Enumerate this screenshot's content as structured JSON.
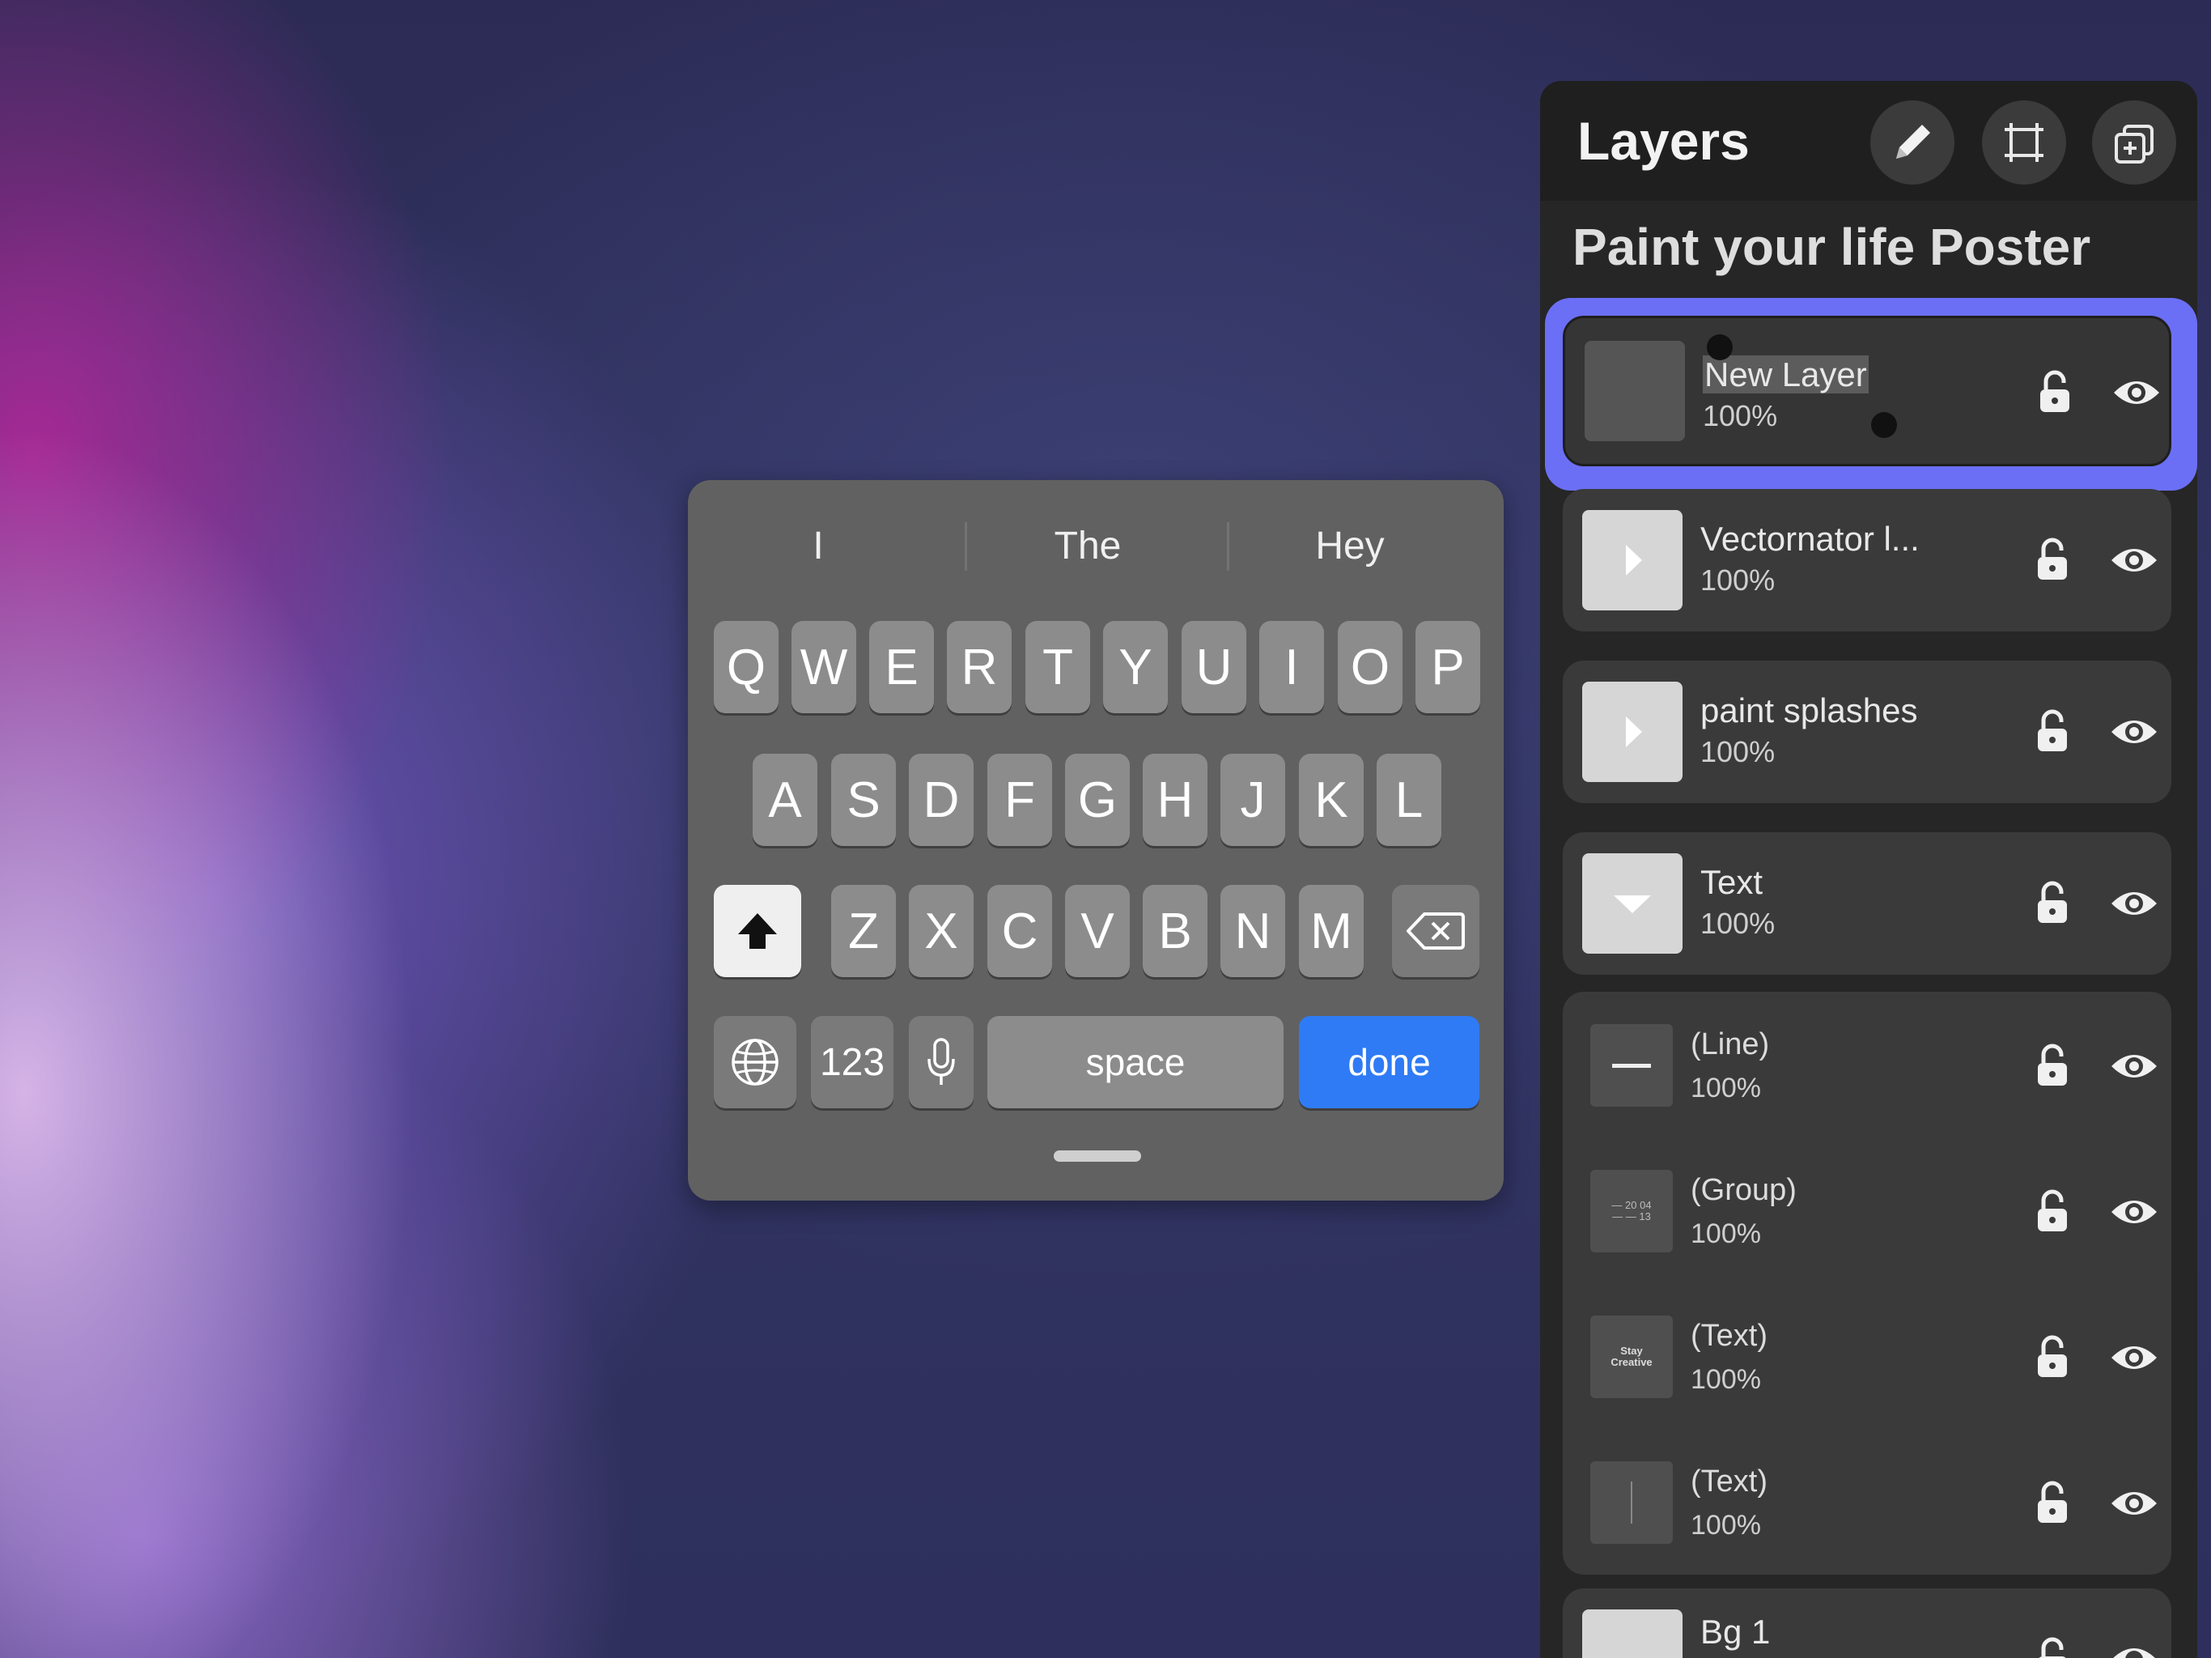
{
  "panel": {
    "title": "Layers",
    "document_title": "Paint your life Poster"
  },
  "layers": [
    {
      "name": "New Layer",
      "opacity": "100%"
    },
    {
      "name": "Vectornator l...",
      "opacity": "100%"
    },
    {
      "name": "paint splashes",
      "opacity": "100%"
    },
    {
      "name": "Text",
      "opacity": "100%"
    }
  ],
  "sublayers": [
    {
      "name": "(Line)",
      "opacity": "100%"
    },
    {
      "name": "(Group)",
      "opacity": "100%",
      "thumb_text": "— 20 04 — — 13"
    },
    {
      "name": "(Text)",
      "opacity": "100%",
      "thumb_text": "Stay Creative"
    },
    {
      "name": "(Text)",
      "opacity": "100%"
    }
  ],
  "last_layer": {
    "name": "Bg 1"
  },
  "keyboard": {
    "suggestions": [
      "I",
      "The",
      "Hey"
    ],
    "row1": [
      "Q",
      "W",
      "E",
      "R",
      "T",
      "Y",
      "U",
      "I",
      "O",
      "P"
    ],
    "row2": [
      "A",
      "S",
      "D",
      "F",
      "G",
      "H",
      "J",
      "K",
      "L"
    ],
    "row3": [
      "Z",
      "X",
      "C",
      "V",
      "B",
      "N",
      "M"
    ],
    "numbers_label": "123",
    "space_label": "space",
    "done_label": "done"
  },
  "colors": {
    "selection_ring": "#6b6ff5",
    "done_key": "#2f7bf5"
  },
  "icons": {
    "header": [
      "pencil-icon",
      "transform-icon",
      "duplicate-icon"
    ],
    "row": [
      "unlock-icon",
      "eye-icon"
    ],
    "keyboard": [
      "shift-icon",
      "backspace-icon",
      "globe-icon",
      "microphone-icon"
    ]
  }
}
